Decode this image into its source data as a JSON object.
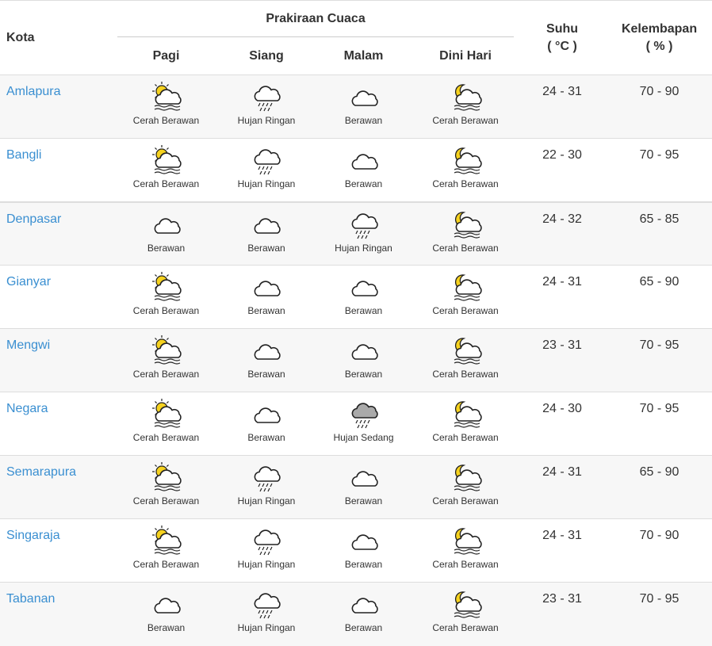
{
  "headers": {
    "kota": "Kota",
    "prakiraan": "Prakiraan Cuaca",
    "pagi": "Pagi",
    "siang": "Siang",
    "malam": "Malam",
    "dini_hari": "Dini Hari",
    "suhu": "Suhu",
    "suhu_unit": "( °C )",
    "kelembapan": "Kelembapan",
    "kelembapan_unit": "( % )"
  },
  "rows": [
    {
      "city": "Amlapura",
      "pagi": "Cerah Berawan",
      "siang": "Hujan Ringan",
      "malam": "Berawan",
      "dini": "Cerah Berawan",
      "suhu": "24 - 31",
      "lembab": "70 - 90"
    },
    {
      "city": "Bangli",
      "pagi": "Cerah Berawan",
      "siang": "Hujan Ringan",
      "malam": "Berawan",
      "dini": "Cerah Berawan",
      "suhu": "22 - 30",
      "lembab": "70 - 95"
    },
    {
      "city": "Denpasar",
      "pagi": "Berawan",
      "siang": "Berawan",
      "malam": "Hujan Ringan",
      "dini": "Cerah Berawan",
      "suhu": "24 - 32",
      "lembab": "65 - 85"
    },
    {
      "city": "Gianyar",
      "pagi": "Cerah Berawan",
      "siang": "Berawan",
      "malam": "Berawan",
      "dini": "Cerah Berawan",
      "suhu": "24 - 31",
      "lembab": "65 - 90"
    },
    {
      "city": "Mengwi",
      "pagi": "Cerah Berawan",
      "siang": "Berawan",
      "malam": "Berawan",
      "dini": "Cerah Berawan",
      "suhu": "23 - 31",
      "lembab": "70 - 95"
    },
    {
      "city": "Negara",
      "pagi": "Cerah Berawan",
      "siang": "Berawan",
      "malam": "Hujan Sedang",
      "dini": "Cerah Berawan",
      "suhu": "24 - 30",
      "lembab": "70 - 95"
    },
    {
      "city": "Semarapura",
      "pagi": "Cerah Berawan",
      "siang": "Hujan Ringan",
      "malam": "Berawan",
      "dini": "Cerah Berawan",
      "suhu": "24 - 31",
      "lembab": "65 - 90"
    },
    {
      "city": "Singaraja",
      "pagi": "Cerah Berawan",
      "siang": "Hujan Ringan",
      "malam": "Berawan",
      "dini": "Cerah Berawan",
      "suhu": "24 - 31",
      "lembab": "70 - 90"
    },
    {
      "city": "Tabanan",
      "pagi": "Berawan",
      "siang": "Hujan Ringan",
      "malam": "Berawan",
      "dini": "Cerah Berawan",
      "suhu": "23 - 31",
      "lembab": "70 - 95"
    }
  ],
  "icons": {
    "Cerah Berawan": "partly-sunny-icon",
    "Cerah Berawan Malam": "partly-cloudy-night-icon",
    "Berawan": "cloud-icon",
    "Hujan Ringan": "light-rain-icon",
    "Hujan Sedang": "moderate-rain-icon"
  },
  "colors": {
    "link": "#3a8fd1",
    "sun": "#f6d21e",
    "alt_row": "#f7f7f7"
  }
}
